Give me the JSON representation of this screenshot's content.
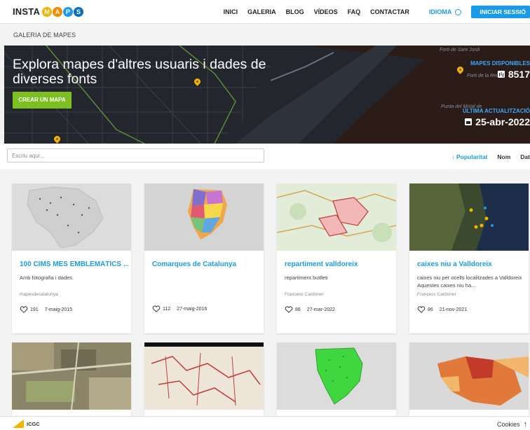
{
  "brand": {
    "word": "INSTA",
    "letters": [
      "M",
      "A",
      "P",
      "S"
    ],
    "letter_colors": [
      "#f3b400",
      "#f08a00",
      "#1a9be8",
      "#0c6cc0"
    ]
  },
  "nav": {
    "items": [
      "INICI",
      "GALERIA",
      "BLOG",
      "VÍDEOS",
      "FAQ",
      "CONTACTAR"
    ],
    "language": "IDIOMA",
    "login": "INICIAR SESSIÓ"
  },
  "breadcrumb": "GALERIA DE MAPES",
  "hero": {
    "title": "Explora mapes d'altres usuaris i dades de diverses fonts",
    "button": "CREAR UN MAPA",
    "maps_label": "MAPES DISPONIBLES",
    "maps_count": "8517",
    "update_label": "ÚLTIMA ACTUALITZACIÓ",
    "update_date": "25-abr-2022",
    "places": [
      "Forti de Sant Jordi",
      "Forti de la Reina",
      "Punta del Moïal de"
    ]
  },
  "search": {
    "placeholder": "Escriu aquí..."
  },
  "sort": {
    "popularity": "Popularitat",
    "name": "Nom",
    "date": "Dat"
  },
  "cards": [
    {
      "title": "100 CIMS MÉS EMBLEMÀTICS ...",
      "description": "Amb fotografia i dades.",
      "author": "mapesdecatalunya",
      "likes": "191",
      "date": "7-maig-2015"
    },
    {
      "title": "Comarques de Catalunya",
      "description": "",
      "author": "",
      "likes": "112",
      "date": "27-maig-2016"
    },
    {
      "title": "repartiment valldoreix",
      "description": "repartiment butlleti",
      "author": "Francesc Cardoner",
      "likes": "86",
      "date": "27-mar-2022"
    },
    {
      "title": "caixes niu a Valldoreix",
      "description": "caixes niu per ocells localitzades a Valldoreix Aquestes caixes niu ha...",
      "author": "Francesc Cardoner",
      "likes": "86",
      "date": "21-nov-2021"
    }
  ],
  "footer": {
    "org": "ICGC",
    "cookies": "Cookies"
  },
  "colors": {
    "accent": "#1a9be8",
    "cta": "#7bbf20",
    "pin": "#f3b400"
  }
}
